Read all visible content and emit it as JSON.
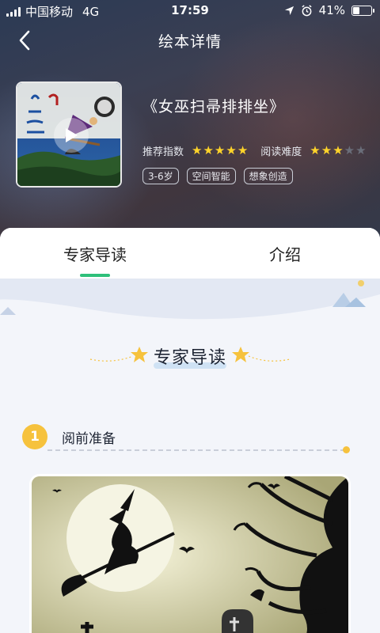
{
  "status_bar": {
    "carrier": "中国移动",
    "network": "4G",
    "time": "17:59",
    "battery": "41%",
    "battery_level": 0.41
  },
  "header": {
    "title": "绘本详情"
  },
  "book": {
    "title": "《女巫扫帚排排坐》",
    "recommend_label": "推荐指数",
    "recommend_stars": 5,
    "difficulty_label": "阅读难度",
    "difficulty_stars": 3,
    "max_stars": 5,
    "tags": [
      "3-6岁",
      "空间智能",
      "想象创造"
    ]
  },
  "tabs": [
    {
      "label": "专家导读",
      "active": true
    },
    {
      "label": "介绍",
      "active": false
    }
  ],
  "content": {
    "section_title": "专家导读",
    "step": {
      "number": "1",
      "title": "阅前准备"
    }
  },
  "colors": {
    "accent_green": "#2ec07a",
    "star_yellow": "#ffd42a",
    "step_yellow": "#f6c23d"
  }
}
